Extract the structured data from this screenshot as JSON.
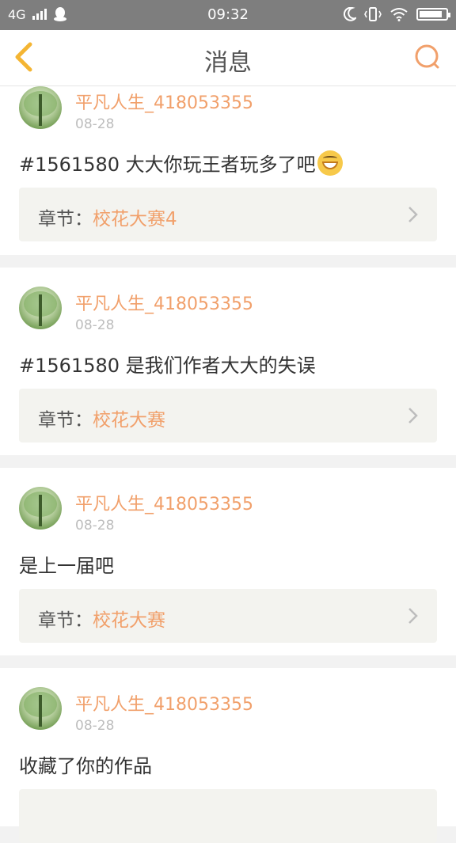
{
  "status_bar": {
    "network": "4G",
    "time": "09:32"
  },
  "header": {
    "title": "消息",
    "back_icon": "chevron-left-icon",
    "search_icon": "search-icon",
    "accent_color": "#f1a06b"
  },
  "messages": [
    {
      "username": "平凡人生_418053355",
      "date": "08-28",
      "text": "#1561580 大大你玩王者玩多了吧",
      "has_emoji": true,
      "chapter_label": "章节：",
      "chapter_value": "校花大赛4"
    },
    {
      "username": "平凡人生_418053355",
      "date": "08-28",
      "text": "#1561580 是我们作者大大的失误",
      "chapter_label": "章节：",
      "chapter_value": "校花大赛"
    },
    {
      "username": "平凡人生_418053355",
      "date": "08-28",
      "text": "是上一届吧",
      "chapter_label": "章节：",
      "chapter_value": "校花大赛"
    },
    {
      "username": "平凡人生_418053355",
      "date": "08-28",
      "text": "收藏了你的作品"
    }
  ]
}
